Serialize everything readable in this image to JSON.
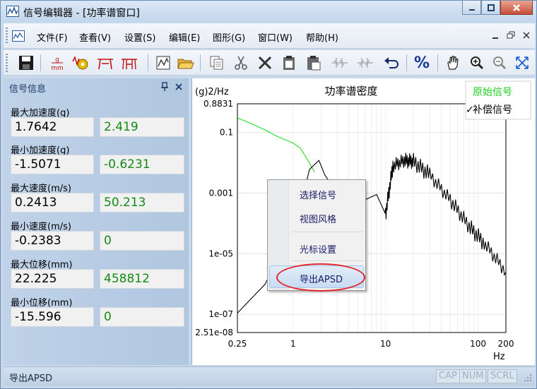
{
  "window": {
    "title": "信号编辑器 - [功率谱窗口]"
  },
  "menu": {
    "items": [
      "文件(F)",
      "查看(V)",
      "设置(S)",
      "编辑(E)",
      "图形(G)",
      "窗口(W)",
      "帮助(H)"
    ]
  },
  "toolbar": {
    "scale_top": "g",
    "scale_bottom": "mm",
    "percent": "%"
  },
  "panel": {
    "title": "信号信息",
    "fields": [
      {
        "label": "最大加速度(g)",
        "value": "1.7642",
        "value2": "2.419"
      },
      {
        "label": "最小加速度(g)",
        "value": "-1.5071",
        "value2": "-0.6231"
      },
      {
        "label": "最大速度(m/s)",
        "value": "0.2413",
        "value2": "50.213"
      },
      {
        "label": "最小速度(m/s)",
        "value": "-0.2383",
        "value2": "0"
      },
      {
        "label": "最大位移(mm)",
        "value": "22.225",
        "value2": "458812"
      },
      {
        "label": "最小位移(mm)",
        "value": "-15.596",
        "value2": "0"
      }
    ]
  },
  "context_menu": {
    "items": [
      "选择信号",
      "视图风格",
      "光标设置",
      "导出APSD"
    ]
  },
  "status": {
    "text": "导出APSD",
    "indicators": [
      "CAP",
      "NUM",
      "SCRL"
    ]
  },
  "colors": {
    "original_signal": "#22dd22",
    "compensated_signal": "#000000",
    "highlight_ring": "#e0262a"
  },
  "chart_data": {
    "type": "line",
    "title": "功率谱密度",
    "ylabel": "(g)2/Hz",
    "xlabel": "Hz",
    "x_scale": "log",
    "y_scale": "log",
    "xlim": [
      0.25,
      200
    ],
    "ylim": [
      2.51e-08,
      0.8831
    ],
    "x_ticks": [
      "0.25",
      "1",
      "10",
      "100",
      "200"
    ],
    "y_ticks": [
      "0.8831",
      "0.1",
      "0.001",
      "1e-05",
      "1e-07",
      "2.51e-08"
    ],
    "legend_position": "top-right",
    "series": [
      {
        "name": "原始信号",
        "checked": false,
        "color": "#22dd22",
        "points": [
          [
            0.25,
            0.3
          ],
          [
            0.35,
            0.2
          ],
          [
            0.5,
            0.12
          ],
          [
            0.7,
            0.07
          ],
          [
            1.0,
            0.045
          ],
          [
            1.2,
            0.03
          ],
          [
            1.5,
            0.01
          ],
          [
            1.7,
            0.005
          ]
        ]
      },
      {
        "name": "补偿信号",
        "checked": true,
        "color": "#000000",
        "points": [
          [
            0.25,
            1.1e-07
          ],
          [
            0.5,
            1e-06
          ],
          [
            0.8,
            2e-05
          ],
          [
            1.2,
            0.0003
          ],
          [
            1.5,
            0.006
          ],
          [
            1.9,
            0.012
          ],
          [
            2.2,
            0.004
          ],
          [
            3.0,
            0.001
          ],
          [
            4.0,
            0.0003
          ],
          [
            6.0,
            0.0006
          ],
          [
            8.0,
            0.0009
          ],
          [
            10.0,
            0.0002
          ],
          [
            12.0,
            0.008
          ],
          [
            16.0,
            0.012
          ],
          [
            20.0,
            0.011
          ],
          [
            30.0,
            0.004
          ],
          [
            50.0,
            0.0006
          ],
          [
            80.0,
            8e-05
          ],
          [
            120.0,
            2e-05
          ],
          [
            200.0,
            2.5e-06
          ]
        ]
      }
    ]
  }
}
